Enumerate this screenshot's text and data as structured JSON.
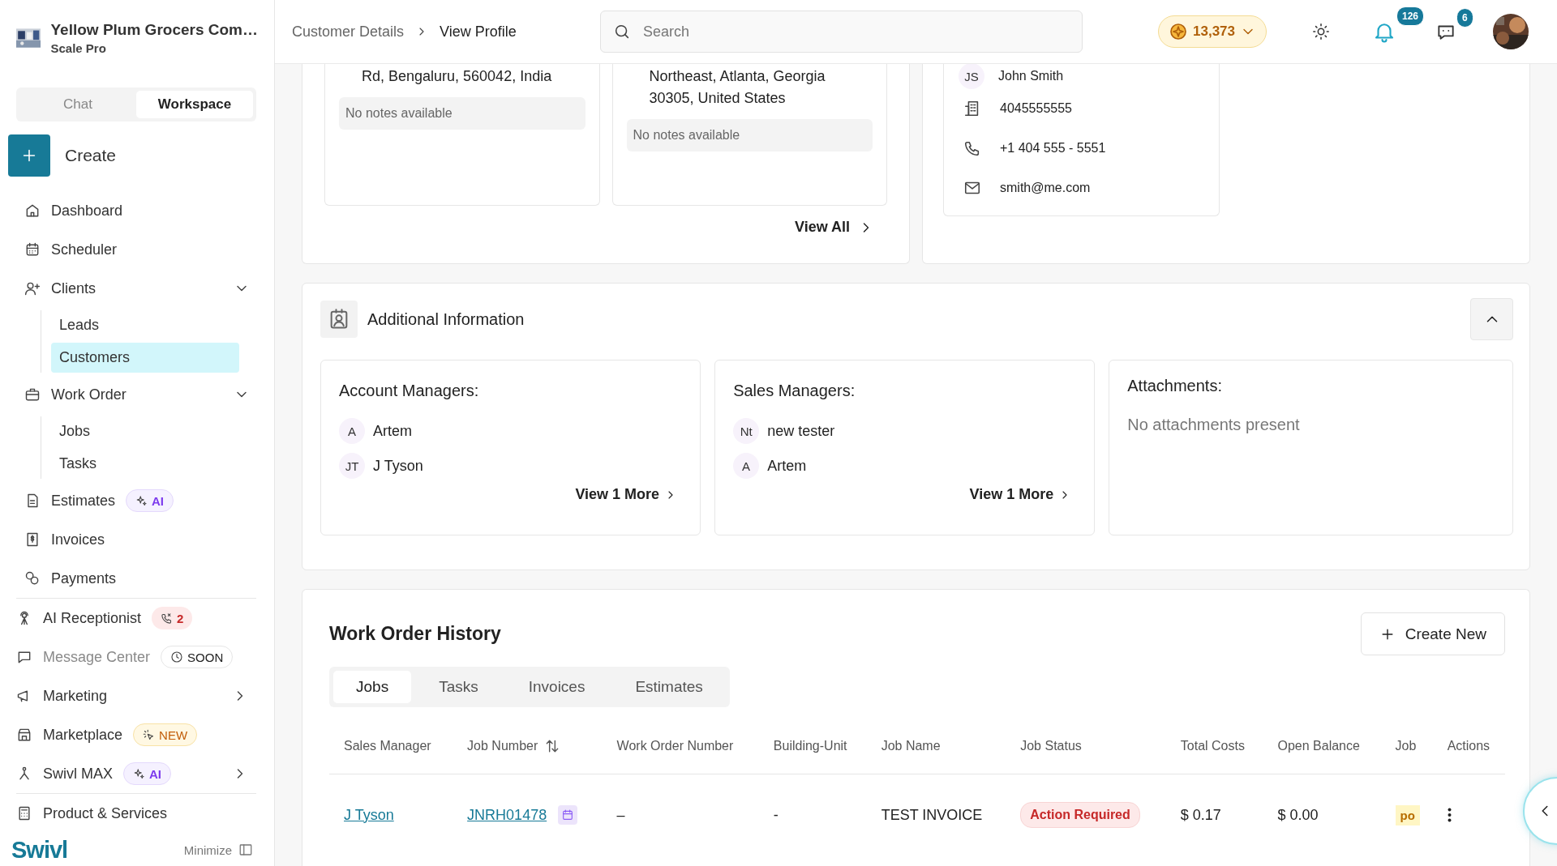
{
  "sidebar": {
    "company": {
      "name": "Yellow Plum Grocers Com…",
      "plan": "Scale Pro"
    },
    "mode_tabs": [
      {
        "label": "Chat",
        "selected": false
      },
      {
        "label": "Workspace",
        "selected": true
      }
    ],
    "create_button": {
      "label": "Create"
    },
    "sections": [
      [
        {
          "label": "Dashboard",
          "selected": false
        },
        {
          "label": "Scheduler",
          "selected": false
        },
        {
          "label": "Clients",
          "selected": false,
          "expanded": true,
          "children": [
            {
              "label": "Leads",
              "selected": false
            },
            {
              "label": "Customers",
              "selected": true
            }
          ]
        },
        {
          "label": "Work Order",
          "selected": false,
          "expanded": true,
          "children": [
            {
              "label": "Jobs",
              "selected": false
            },
            {
              "label": "Tasks",
              "selected": false
            }
          ]
        },
        {
          "label": "Estimates",
          "selected": false,
          "badge": {
            "kind": "ai",
            "text": "AI"
          }
        },
        {
          "label": "Invoices",
          "selected": false
        },
        {
          "label": "Payments",
          "selected": false
        }
      ],
      [
        {
          "label": "AI Receptionist",
          "selected": false,
          "badge": {
            "kind": "calls",
            "text": "2"
          }
        },
        {
          "label": "Message Center",
          "selected": false,
          "disabled": true,
          "badge": {
            "kind": "soon",
            "text": "SOON"
          }
        },
        {
          "label": "Marketing",
          "selected": false,
          "expanded": false
        },
        {
          "label": "Marketplace",
          "selected": false,
          "badge": {
            "kind": "new",
            "text": "NEW"
          }
        },
        {
          "label": "Swivl MAX",
          "selected": false,
          "expanded": false,
          "badge": {
            "kind": "ai",
            "text": "AI"
          }
        }
      ],
      [
        {
          "label": "Product & Services",
          "selected": false
        }
      ]
    ],
    "footer": {
      "logo": "Swivl",
      "minimize": "Minimize"
    }
  },
  "header": {
    "breadcrumb": [
      {
        "label": "Customer Details"
      },
      {
        "label": "View Profile"
      }
    ],
    "search": {
      "placeholder": "Search"
    },
    "coins": "13,373",
    "notifications": "126",
    "messages": "6"
  },
  "locations": {
    "addresses": [
      {
        "address": "Rd, Bengaluru, 560042, India",
        "notes": "No notes available"
      },
      {
        "address": "Northeast, Atlanta, Georgia 30305, United States",
        "notes": "No notes available"
      }
    ],
    "view_all": "View All"
  },
  "contact": {
    "initials": "JS",
    "name": "John Smith",
    "rows": [
      {
        "kind": "office",
        "text": "4045555555"
      },
      {
        "kind": "phone",
        "text": "+1 404 555 - 5551"
      },
      {
        "kind": "email",
        "text": "smith@me.com"
      }
    ]
  },
  "additional_info": {
    "title": "Additional Information",
    "expanded": true,
    "cards": [
      {
        "kind": "people",
        "title": "Account Managers:",
        "people": [
          {
            "initials": "A",
            "name": "Artem"
          },
          {
            "initials": "JT",
            "name": "J Tyson"
          }
        ],
        "more": "View 1 More"
      },
      {
        "kind": "people",
        "title": "Sales Managers:",
        "people": [
          {
            "initials": "Nt",
            "name": "new tester"
          },
          {
            "initials": "A",
            "name": "Artem"
          }
        ],
        "more": "View 1 More"
      },
      {
        "kind": "attachments",
        "title": "Attachments:",
        "empty": "No attachments present"
      }
    ]
  },
  "work_orders": {
    "title": "Work Order History",
    "create_button": "Create New",
    "tabs": [
      {
        "label": "Jobs",
        "selected": true
      },
      {
        "label": "Tasks",
        "selected": false
      },
      {
        "label": "Invoices",
        "selected": false
      },
      {
        "label": "Estimates",
        "selected": false
      }
    ],
    "table": {
      "columns": [
        {
          "label": "Sales Manager",
          "sortable": false
        },
        {
          "label": "Job Number",
          "sortable": true
        },
        {
          "label": "Work Order Number",
          "sortable": false
        },
        {
          "label": "Building-Unit",
          "sortable": false
        },
        {
          "label": "Job Name",
          "sortable": false
        },
        {
          "label": "Job Status",
          "sortable": false
        },
        {
          "label": "Total Costs",
          "sortable": false
        },
        {
          "label": "Open Balance",
          "sortable": false
        },
        {
          "label": "Job",
          "sortable": false
        },
        {
          "label": "Actions",
          "sortable": false
        }
      ],
      "rows": [
        {
          "cells": [
            {
              "kind": "link",
              "text": "J Tyson"
            },
            {
              "kind": "job_link",
              "text": "JNRH01478"
            },
            {
              "kind": "text",
              "text": "–"
            },
            {
              "kind": "text",
              "text": "-"
            },
            {
              "kind": "text",
              "text": "TEST INVOICE"
            },
            {
              "kind": "status",
              "text": "Action Required"
            },
            {
              "kind": "text",
              "text": "$ 0.17"
            },
            {
              "kind": "text",
              "text": "$ 0.00"
            },
            {
              "kind": "tag",
              "text": "po"
            },
            {
              "kind": "menu"
            }
          ]
        }
      ]
    }
  }
}
